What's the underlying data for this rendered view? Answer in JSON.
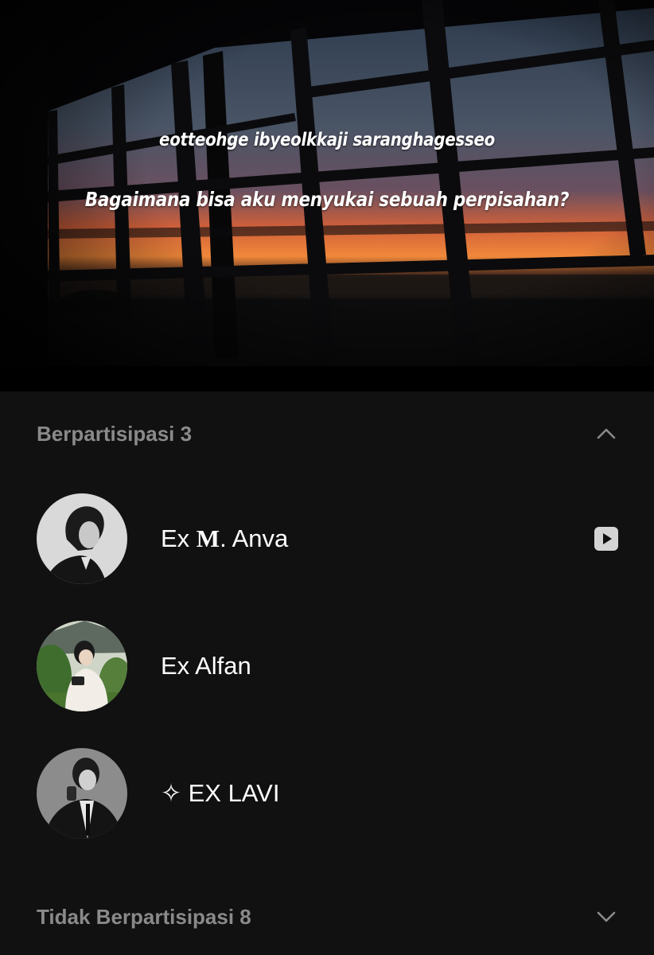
{
  "banner": {
    "caption_line1": "eotteohge ibyeolkkaji saranghagesseo",
    "caption_line2": "Bagaimana bisa aku menyukai sebuah perpisahan?"
  },
  "sections": {
    "participating": {
      "label": "Berpartisipasi 3",
      "icon": "chevron-up-icon"
    },
    "not_participating": {
      "label": "Tidak Berpartisipasi 8",
      "icon": "chevron-down-icon"
    }
  },
  "members": [
    {
      "name_prefix": "Ex ",
      "name_styled": "M",
      "name_suffix": ". Anva",
      "avatar": "avatar-grayscale-portrait",
      "badge": "play-icon"
    },
    {
      "name": "Ex Alfan",
      "avatar": "avatar-camera-garden"
    },
    {
      "name_symbol": "✧",
      "name": " EX LAVI",
      "avatar": "avatar-grayscale-suit"
    }
  ],
  "colors": {
    "background": "#111111",
    "section_label": "#8a8a8a",
    "text": "#ffffff"
  }
}
